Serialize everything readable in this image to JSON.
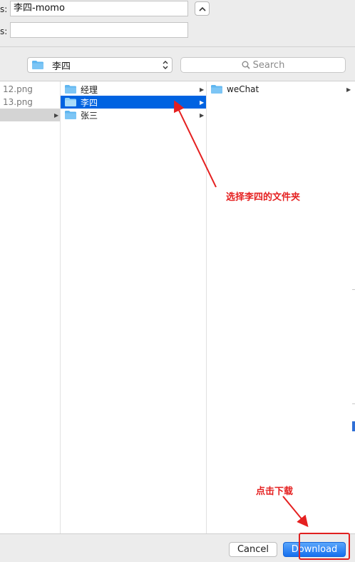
{
  "form": {
    "name_label_fragment": "s:",
    "name_value": "李四-momo",
    "tags_label_fragment": "s:",
    "tags_value": ""
  },
  "location": {
    "selected_folder": "李四",
    "search_placeholder": "Search"
  },
  "columns": {
    "first": [
      {
        "label": "12.png"
      },
      {
        "label": "13.png"
      }
    ],
    "second": [
      {
        "label": "经理"
      },
      {
        "label": "李四"
      },
      {
        "label": "张三"
      }
    ],
    "third": [
      {
        "label": "weChat"
      }
    ]
  },
  "annotations": {
    "select_folder_note": "选择李四的文件夹",
    "click_download_note": "点击下载"
  },
  "buttons": {
    "cancel": "Cancel",
    "download": "Download"
  },
  "colors": {
    "selection": "#0063e1",
    "primary_button": "#1670ef",
    "annotation": "#e52020",
    "folder_icon": "#5fb6f0"
  },
  "icons": {
    "folder": "folder-icon",
    "search": "search-icon",
    "disclosure": "chevron-right-icon",
    "collapse": "chevron-up-icon"
  }
}
